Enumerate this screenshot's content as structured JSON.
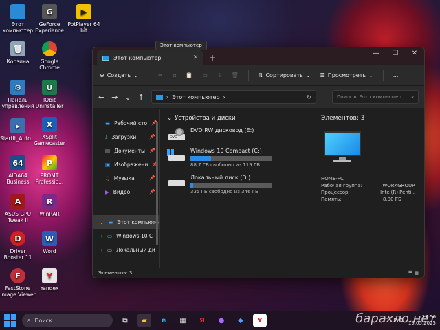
{
  "desktop": {
    "icons": [
      {
        "label": "Этот компьютер",
        "name": "this-pc"
      },
      {
        "label": "GeForce Experience",
        "name": "geforce"
      },
      {
        "label": "PotPlayer 64 bit",
        "name": "potplayer"
      },
      {
        "label": "Корзина",
        "name": "recycle-bin"
      },
      {
        "label": "Google Chrome",
        "name": "chrome"
      },
      {
        "label": "Панель управления",
        "name": "control-panel"
      },
      {
        "label": "IObit Uninstaller",
        "name": "iobit"
      },
      {
        "label": "StartIt_Auto...",
        "name": "startit"
      },
      {
        "label": "XSplit Gamecaster",
        "name": "xsplit"
      },
      {
        "label": "AIDA64 Business",
        "name": "aida64"
      },
      {
        "label": "PROMT Professio...",
        "name": "promt"
      },
      {
        "label": "ASUS GPU Tweak II",
        "name": "asus-gpu"
      },
      {
        "label": "WinRAR",
        "name": "winrar"
      },
      {
        "label": "Driver Booster 11",
        "name": "driver-booster"
      },
      {
        "label": "Word",
        "name": "word"
      },
      {
        "label": "FastStone Image Viewer",
        "name": "faststone"
      },
      {
        "label": "Yandex",
        "name": "yandex"
      }
    ]
  },
  "tooltip": "Этот компьютер",
  "window": {
    "tab_title": "Этот компьютер",
    "toolbar": {
      "create": "Создать",
      "sort": "Сортировать",
      "view": "Просмотреть",
      "more": "..."
    },
    "address": "Этот компьютер",
    "search_placeholder": "Поиск в: Этот компьютер",
    "nav": {
      "quick": [
        {
          "label": "Рабочий сто",
          "icon": "desktop-icon"
        },
        {
          "label": "Загрузки",
          "icon": "downloads-icon"
        },
        {
          "label": "Документы",
          "icon": "documents-icon"
        },
        {
          "label": "Изображени",
          "icon": "pictures-icon"
        },
        {
          "label": "Музыка",
          "icon": "music-icon"
        },
        {
          "label": "Видео",
          "icon": "video-icon"
        }
      ],
      "this_pc": "Этот компьюте",
      "drives": [
        "Windows 10 C",
        "Локальный ди"
      ]
    },
    "section_title": "Устройства и диски",
    "drives": [
      {
        "name": "DVD RW дисковод (E:)",
        "type": "dvd",
        "free_text": "",
        "used_fraction": null
      },
      {
        "name": "Windows 10 Compact  (C:)",
        "type": "system",
        "free_text": "88,7 ГБ свободно из 119 ГБ",
        "used_fraction": 0.25
      },
      {
        "name": "Локальный диск (D:)",
        "type": "hdd",
        "free_text": "335 ГБ свободно из 346 ГБ",
        "used_fraction": 0.03
      }
    ],
    "details": {
      "count": "Элементов: 3",
      "rows": [
        {
          "k": "HOME-PC",
          "v": ""
        },
        {
          "k": "Рабочая группа:",
          "v": "WORKGROUP"
        },
        {
          "k": "Процессор:",
          "v": "Intel(R) Penti..."
        },
        {
          "k": "Память:",
          "v": "8,00 ГБ"
        }
      ]
    },
    "status": "Элементов: 3"
  },
  "taskbar": {
    "search": "Поиск",
    "lang": "РУС",
    "time": "17:56",
    "date": "19.05.2025"
  },
  "watermark": "барахло.нет"
}
